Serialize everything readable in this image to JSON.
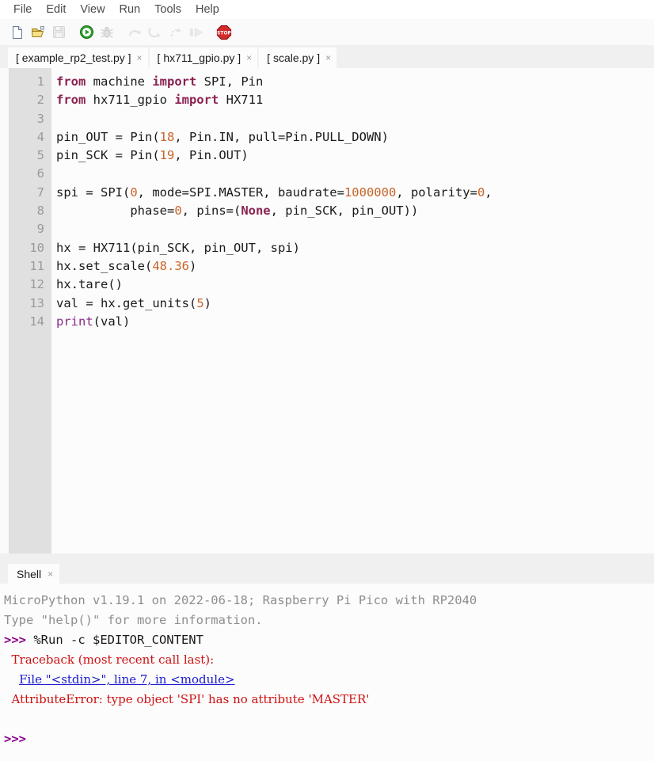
{
  "app": {
    "name": "Thonny",
    "accent_green": "#2a9d2a",
    "accent_red": "#cc2222",
    "keyword_color": "#8b2252",
    "number_color": "#c86428",
    "builtin_color": "#8b2b8b",
    "error_color": "#cc1111",
    "link_color": "#1a1ad0",
    "gutter_bg": "#e0e0e0",
    "prompt_color": "#8b008b"
  },
  "menubar": {
    "items": [
      {
        "label": "File",
        "name": "menu-file"
      },
      {
        "label": "Edit",
        "name": "menu-edit"
      },
      {
        "label": "View",
        "name": "menu-view"
      },
      {
        "label": "Run",
        "name": "menu-run"
      },
      {
        "label": "Tools",
        "name": "menu-tools"
      },
      {
        "label": "Help",
        "name": "menu-help"
      }
    ]
  },
  "toolbar": {
    "buttons": [
      {
        "icon": "new-file-icon",
        "title": "New",
        "enabled": true
      },
      {
        "icon": "open-folder-icon",
        "title": "Load",
        "enabled": true
      },
      {
        "icon": "save-icon",
        "title": "Save",
        "enabled": false
      },
      {
        "icon": "run-play-icon",
        "title": "Run current script",
        "enabled": true
      },
      {
        "icon": "debug-bug-icon",
        "title": "Debug current script",
        "enabled": false
      },
      {
        "icon": "step-over-icon",
        "title": "Step over",
        "enabled": false
      },
      {
        "icon": "step-into-icon",
        "title": "Step into",
        "enabled": false
      },
      {
        "icon": "step-out-icon",
        "title": "Step out",
        "enabled": false
      },
      {
        "icon": "resume-icon",
        "title": "Resume",
        "enabled": false
      },
      {
        "icon": "stop-icon",
        "title": "Stop/Restart backend",
        "enabled": true
      }
    ]
  },
  "editor": {
    "tabs": [
      {
        "label": "[ example_rp2_test.py ]",
        "close": "×",
        "active": false
      },
      {
        "label": "[ hx711_gpio.py ]",
        "close": "×",
        "active": false
      },
      {
        "label": "[ scale.py ]",
        "close": "×",
        "active": true
      }
    ],
    "line_numbers": [
      "1",
      "2",
      "3",
      "4",
      "5",
      "6",
      "7",
      "8",
      "9",
      "10",
      "11",
      "12",
      "13",
      "14"
    ],
    "lines": [
      [
        {
          "t": "from",
          "c": "kw"
        },
        {
          "t": " machine ",
          "c": ""
        },
        {
          "t": "import",
          "c": "kw"
        },
        {
          "t": " SPI, Pin",
          "c": ""
        }
      ],
      [
        {
          "t": "from",
          "c": "kw"
        },
        {
          "t": " hx711_gpio ",
          "c": ""
        },
        {
          "t": "import",
          "c": "kw"
        },
        {
          "t": " HX711",
          "c": ""
        }
      ],
      [
        {
          "t": "",
          "c": ""
        }
      ],
      [
        {
          "t": "pin_OUT = Pin(",
          "c": ""
        },
        {
          "t": "18",
          "c": "num"
        },
        {
          "t": ", Pin.IN, pull=Pin.PULL_DOWN)",
          "c": ""
        }
      ],
      [
        {
          "t": "pin_SCK = Pin(",
          "c": ""
        },
        {
          "t": "19",
          "c": "num"
        },
        {
          "t": ", Pin.OUT)",
          "c": ""
        }
      ],
      [
        {
          "t": "",
          "c": ""
        }
      ],
      [
        {
          "t": "spi = SPI(",
          "c": ""
        },
        {
          "t": "0",
          "c": "num"
        },
        {
          "t": ", mode=SPI.MASTER, baudrate=",
          "c": ""
        },
        {
          "t": "1000000",
          "c": "num"
        },
        {
          "t": ", polarity=",
          "c": ""
        },
        {
          "t": "0",
          "c": "num"
        },
        {
          "t": ",",
          "c": ""
        }
      ],
      [
        {
          "t": "          phase=",
          "c": ""
        },
        {
          "t": "0",
          "c": "num"
        },
        {
          "t": ", pins=(",
          "c": ""
        },
        {
          "t": "None",
          "c": "none"
        },
        {
          "t": ", pin_SCK, pin_OUT))",
          "c": ""
        }
      ],
      [
        {
          "t": "",
          "c": ""
        }
      ],
      [
        {
          "t": "hx = HX711(pin_SCK, pin_OUT, spi)",
          "c": ""
        }
      ],
      [
        {
          "t": "hx.set_scale(",
          "c": ""
        },
        {
          "t": "48.36",
          "c": "num"
        },
        {
          "t": ")",
          "c": ""
        }
      ],
      [
        {
          "t": "hx.tare()",
          "c": ""
        }
      ],
      [
        {
          "t": "val = hx.get_units(",
          "c": ""
        },
        {
          "t": "5",
          "c": "num"
        },
        {
          "t": ")",
          "c": ""
        }
      ],
      [
        {
          "t": "print",
          "c": "bif"
        },
        {
          "t": "(val)",
          "c": ""
        }
      ]
    ]
  },
  "shell": {
    "tab": {
      "label": "Shell",
      "close": "×"
    },
    "lines": [
      [
        {
          "t": "MicroPython v1.19.1 on 2022-06-18; Raspberry Pi Pico with RP2040",
          "c": "sh-gray"
        }
      ],
      [
        {
          "t": "Type \"help()\" for more information.",
          "c": "sh-gray"
        }
      ],
      [
        {
          "t": ">>>",
          "c": "sh-prompt"
        },
        {
          "t": " %Run -c $EDITOR_CONTENT",
          "c": "sh-dark"
        }
      ],
      [
        {
          "t": "  Traceback (most recent call last):",
          "c": "sh-err"
        }
      ],
      [
        {
          "t": "    ",
          "c": "sh-err"
        },
        {
          "t": "File \"<stdin>\", line 7, in <module>",
          "c": "sh-link"
        }
      ],
      [
        {
          "t": "  AttributeError: type object 'SPI' has no attribute 'MASTER'",
          "c": "sh-err"
        }
      ],
      [
        {
          "t": "",
          "c": ""
        }
      ],
      [
        {
          "t": ">>>",
          "c": "sh-prompt"
        }
      ]
    ]
  }
}
